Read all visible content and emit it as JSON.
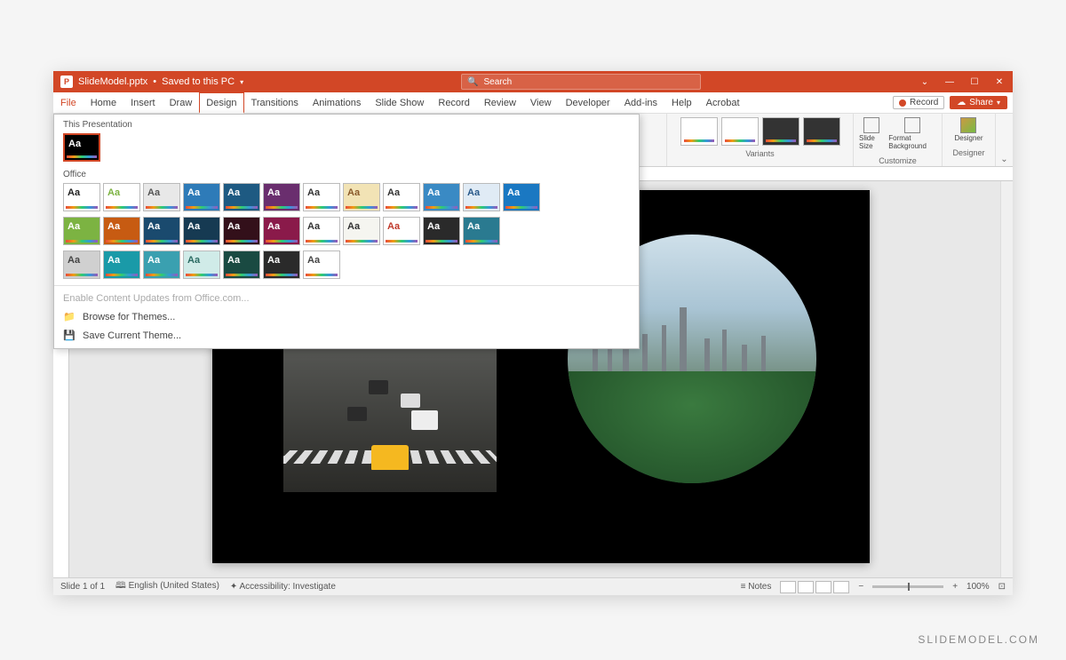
{
  "titlebar": {
    "filename": "SlideModel.pptx",
    "save_state": "Saved to this PC",
    "search_placeholder": "Search"
  },
  "ribbon": {
    "tabs": [
      "File",
      "Home",
      "Insert",
      "Draw",
      "Design",
      "Transitions",
      "Animations",
      "Slide Show",
      "Record",
      "Review",
      "View",
      "Developer",
      "Add-ins",
      "Help",
      "Acrobat"
    ],
    "active_tab": "Design",
    "record_label": "Record",
    "share_label": "Share",
    "variants_label": "Variants",
    "customize_label": "Customize",
    "slide_size_label": "Slide Size",
    "format_bg_label": "Format Background",
    "designer_label": "Designer",
    "designer_group_label": "Designer"
  },
  "themes_panel": {
    "section_current": "This Presentation",
    "section_office": "Office",
    "enable_updates": "Enable Content Updates from Office.com...",
    "browse": "Browse for Themes...",
    "save_current": "Save Current Theme...",
    "current_theme_aa": "Aa",
    "office_themes": [
      {
        "aa": "Aa",
        "bg": "#ffffff",
        "fg": "#222"
      },
      {
        "aa": "Aa",
        "bg": "#ffffff",
        "fg": "#7cb342"
      },
      {
        "aa": "Aa",
        "bg": "#e8e8e8",
        "fg": "#555"
      },
      {
        "aa": "Aa",
        "bg": "#2e7bb8",
        "fg": "#fff"
      },
      {
        "aa": "Aa",
        "bg": "#1e5a82",
        "fg": "#fff"
      },
      {
        "aa": "Aa",
        "bg": "#6a2e6e",
        "fg": "#fff"
      },
      {
        "aa": "Aa",
        "bg": "#ffffff",
        "fg": "#333"
      },
      {
        "aa": "Aa",
        "bg": "#f2e3b5",
        "fg": "#8a5a2b"
      },
      {
        "aa": "Aa",
        "bg": "#ffffff",
        "fg": "#333"
      },
      {
        "aa": "Aa",
        "bg": "#3a8ac4",
        "fg": "#fff"
      },
      {
        "aa": "Aa",
        "bg": "#e0ebf5",
        "fg": "#2a5a8a"
      },
      {
        "aa": "Aa",
        "bg": "#1a78c2",
        "fg": "#fff"
      },
      {
        "aa": "Aa",
        "bg": "#7cb342",
        "fg": "#fff"
      },
      {
        "aa": "Aa",
        "bg": "#c75b12",
        "fg": "#fff"
      },
      {
        "aa": "Aa",
        "bg": "#1a4a6e",
        "fg": "#fff"
      },
      {
        "aa": "Aa",
        "bg": "#163a52",
        "fg": "#fff"
      },
      {
        "aa": "Aa",
        "bg": "#33101a",
        "fg": "#fff"
      },
      {
        "aa": "Aa",
        "bg": "#8a1a4a",
        "fg": "#fff"
      },
      {
        "aa": "Aa",
        "bg": "#ffffff",
        "fg": "#333"
      },
      {
        "aa": "Aa",
        "bg": "#f5f5f0",
        "fg": "#333"
      },
      {
        "aa": "Aa",
        "bg": "#ffffff",
        "fg": "#c0392b"
      },
      {
        "aa": "Aa",
        "bg": "#2a2a2a",
        "fg": "#fff"
      },
      {
        "aa": "Aa",
        "bg": "#2a7a90",
        "fg": "#fff"
      },
      {
        "aa": "Aa",
        "bg": "#d0d0d0",
        "fg": "#444"
      },
      {
        "aa": "Aa",
        "bg": "#1a9aa8",
        "fg": "#fff"
      },
      {
        "aa": "Aa",
        "bg": "#3aa0b0",
        "fg": "#fff"
      },
      {
        "aa": "Aa",
        "bg": "#d0ebe8",
        "fg": "#2a6a62"
      },
      {
        "aa": "Aa",
        "bg": "#1a4a42",
        "fg": "#fff"
      },
      {
        "aa": "Aa",
        "bg": "#2a2a2a",
        "fg": "#fff"
      },
      {
        "aa": "Aa",
        "bg": "#ffffff",
        "fg": "#444"
      }
    ]
  },
  "statusbar": {
    "slide_info": "Slide 1 of 1",
    "language": "English (United States)",
    "accessibility": "Accessibility: Investigate",
    "notes": "Notes",
    "zoom": "100%"
  },
  "watermark": "SLIDEMODEL.COM"
}
